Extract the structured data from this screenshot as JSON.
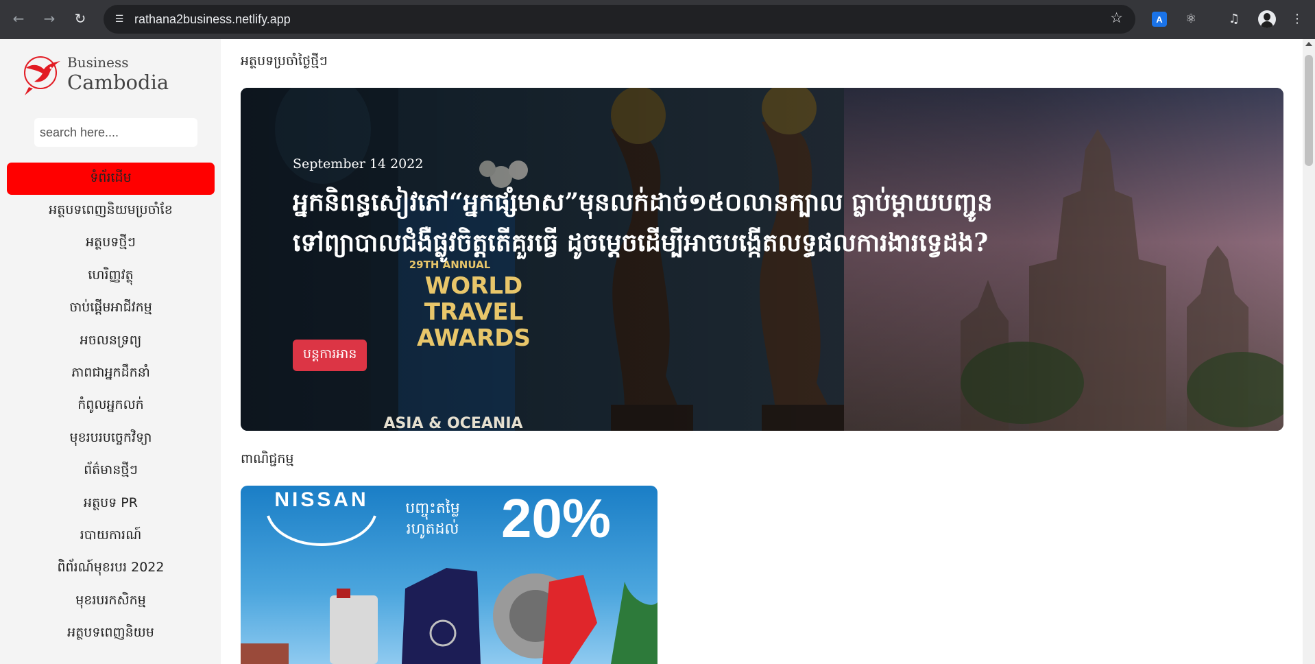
{
  "browser": {
    "url": "rathana2business.netlify.app",
    "back_icon": "arrow-left",
    "forward_icon": "arrow-right",
    "reload_icon": "reload",
    "site_info_icon": "tune",
    "bookmark_icon": "star",
    "extensions": [
      "translate-icon",
      "puzzle-icon",
      "media-control-icon",
      "profile-avatar",
      "menu-dots-icon"
    ]
  },
  "sidebar": {
    "logo": {
      "line1": "Business",
      "line2": "Cambodia",
      "accent_color": "#e21b23"
    },
    "search": {
      "placeholder": "search here...."
    },
    "items": [
      {
        "label": "ទំព័រដើម",
        "active": true
      },
      {
        "label": "អត្ថបទពេញនិយមប្រចាំខែ"
      },
      {
        "label": "អត្ថបទថ្មីៗ"
      },
      {
        "label": "ហេរិញ្ញវត្ថុ"
      },
      {
        "label": "ចាប់ផ្តើមអាជីវកម្ម"
      },
      {
        "label": "អចលនទ្រព្យ"
      },
      {
        "label": "ភាពជាអ្នកដឹកនាំ"
      },
      {
        "label": "កំពូលអ្នកលក់"
      },
      {
        "label": "មុខរបរបច្ចេកវិទ្យា"
      },
      {
        "label": "ព័ត៌មានថ្មីៗ"
      },
      {
        "label": "អត្ថបទ PR"
      },
      {
        "label": "របាយការណ៍"
      },
      {
        "label": "ពិព័រណ៍មុខរបរ 2022"
      },
      {
        "label": "មុខរបរកសិកម្ម"
      },
      {
        "label": "អត្ថបទពេញនិយម"
      }
    ],
    "active_color": "#ff0000"
  },
  "main": {
    "daily_section_title": "អត្ថបទប្រចាំថ្ងៃថ្មីៗ",
    "hero": {
      "date": "September 14 2022",
      "title": "អ្នកនិពន្ធសៀវភៅ“អ្នកផ្សំមាស”មុនលក់ដាច់១៥០លានក្បាល ធ្លាប់ម្តាយបញ្ជូនទៅព្យាបាលជំងឺផ្លូវចិត្តតើគួរធ្វើ ដូចម្តេចដើម្បីអាចបង្កើតលទ្ធផលការងារទ្វេដង?",
      "button_label": "បន្តការអាន",
      "button_color": "#dc3545",
      "image_text": [
        "29TH ANNUAL",
        "WORLD",
        "TRAVEL",
        "AWARDS",
        "ASIA & OCEANIA"
      ]
    },
    "commerce_section_title": "ពាណិជ្ជកម្ម",
    "ad": {
      "brand": "NISSAN",
      "promo_text": "បញ្ចុះតម្លៃ",
      "promo_sub": "រហូតដល់",
      "discount": "20%"
    }
  }
}
